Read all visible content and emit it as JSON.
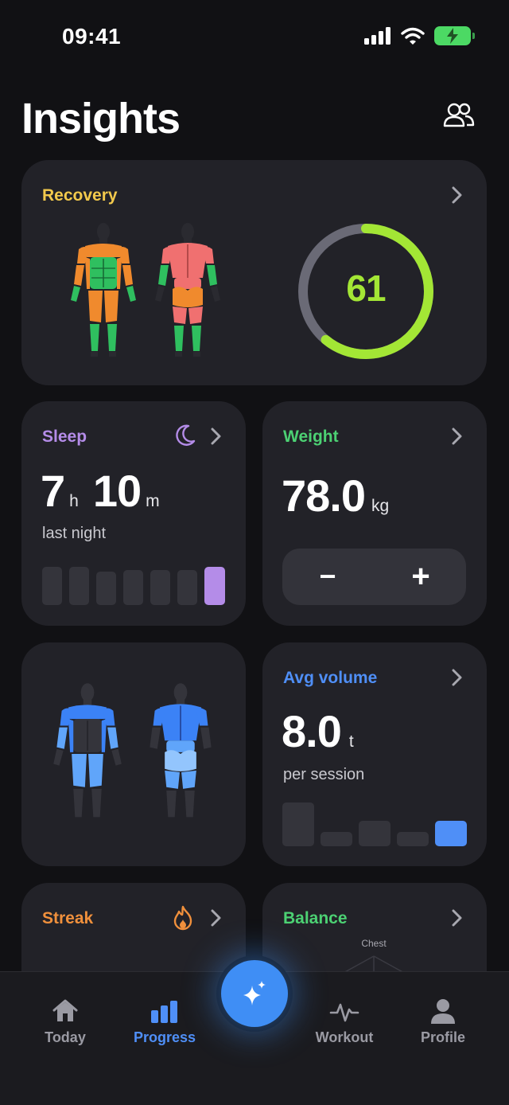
{
  "status_bar": {
    "time": "09:41"
  },
  "page": {
    "title": "Insights"
  },
  "recovery": {
    "title": "Recovery",
    "score": "61",
    "score_fraction": 0.61,
    "colors": {
      "title": "#f2c94c",
      "ring": "#a3e635",
      "ring_track": "#6a6a76"
    }
  },
  "sleep": {
    "title": "Sleep",
    "hours": "7",
    "hours_unit": "h",
    "minutes": "10",
    "minutes_unit": "m",
    "caption": "last night",
    "bars": 7,
    "highlight_color": "#b48ce8"
  },
  "weight": {
    "title": "Weight",
    "value": "78.0",
    "unit": "kg",
    "decrement": "−",
    "increment": "+"
  },
  "avg_volume": {
    "title": "Avg volume",
    "value": "8.0",
    "unit": "t",
    "caption": "per session",
    "accent": "#4f8ff7"
  },
  "streak": {
    "title": "Streak",
    "accent": "#f0903c"
  },
  "balance": {
    "title": "Balance",
    "axis_label": "Chest",
    "accent": "#4cd173"
  },
  "nav": {
    "items": [
      {
        "label": "Today",
        "icon": "home-icon"
      },
      {
        "label": "Progress",
        "icon": "bar-chart-icon"
      },
      {
        "label": "Workout",
        "icon": "heartbeat-icon"
      },
      {
        "label": "Profile",
        "icon": "person-icon"
      }
    ],
    "fab_icon": "sparkles-icon",
    "active_color": "#4f8ff7"
  }
}
